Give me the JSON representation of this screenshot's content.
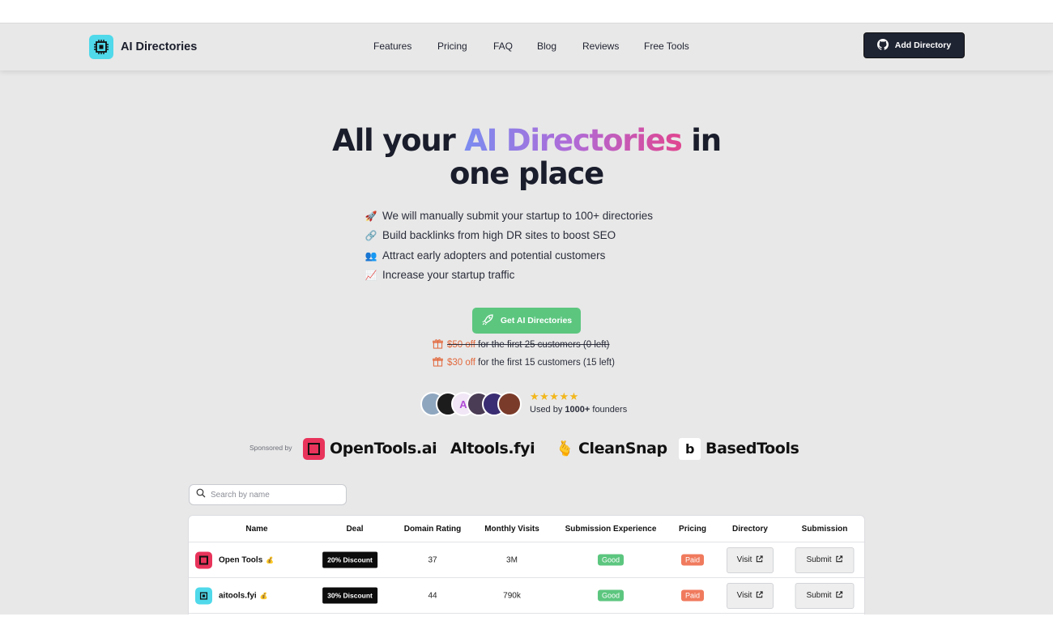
{
  "brand": {
    "name": "AI Directories"
  },
  "nav": {
    "links": [
      "Features",
      "Pricing",
      "FAQ",
      "Blog",
      "Reviews",
      "Free Tools"
    ],
    "cta_label": "Add Directory"
  },
  "hero": {
    "title_part1": "All your ",
    "title_highlight": "AI Directories",
    "title_part2": " in",
    "title_line2": "one place",
    "bullets": [
      {
        "emoji": "🚀",
        "text": "We will manually submit your startup to 100+ directories"
      },
      {
        "emoji": "🔗",
        "text": "Build backlinks from high DR sites to boost SEO"
      },
      {
        "emoji": "👥",
        "text": "Attract early adopters and potential customers"
      },
      {
        "emoji": "📈",
        "text": "Increase your startup traffic"
      }
    ],
    "cta_label": "Get AI Directories",
    "deals": [
      {
        "price": "$50 off",
        "text": "for the first 25 customers (0 left)"
      },
      {
        "price": "$30 off",
        "text": "for the first 15 customers (15 left)"
      }
    ],
    "rating_stars": "★★★★★",
    "used_prefix": "Used by ",
    "used_count": "1000+",
    "used_suffix": " founders"
  },
  "sponsors": {
    "label": "Sponsored by",
    "items": [
      "OpenTools.ai",
      "tools.fyi",
      "CleanSnap",
      "BasedTools"
    ],
    "aitools_prefix": "Al"
  },
  "search": {
    "placeholder": "Search by name"
  },
  "table": {
    "columns": [
      "Name",
      "Deal",
      "Domain Rating",
      "Monthly Visits",
      "Submission Experience",
      "Pricing",
      "Directory",
      "Submission"
    ],
    "rows": [
      {
        "name": "Open Tools",
        "badge": "💰",
        "deal": "20% Discount",
        "dr": "37",
        "visits": "3M",
        "experience": "Good",
        "pricing": "Paid",
        "visit": "Visit",
        "submit": "Submit"
      },
      {
        "name": "aitools.fyi",
        "badge": "💰",
        "deal": "30% Discount",
        "dr": "44",
        "visits": "790k",
        "experience": "Good",
        "pricing": "Paid",
        "visit": "Visit",
        "submit": "Submit"
      }
    ]
  },
  "colors": {
    "accent_green": "#5cc67f",
    "dark": "#1f2433",
    "paid": "#f07a5d",
    "logo": "#4fd9ea"
  }
}
